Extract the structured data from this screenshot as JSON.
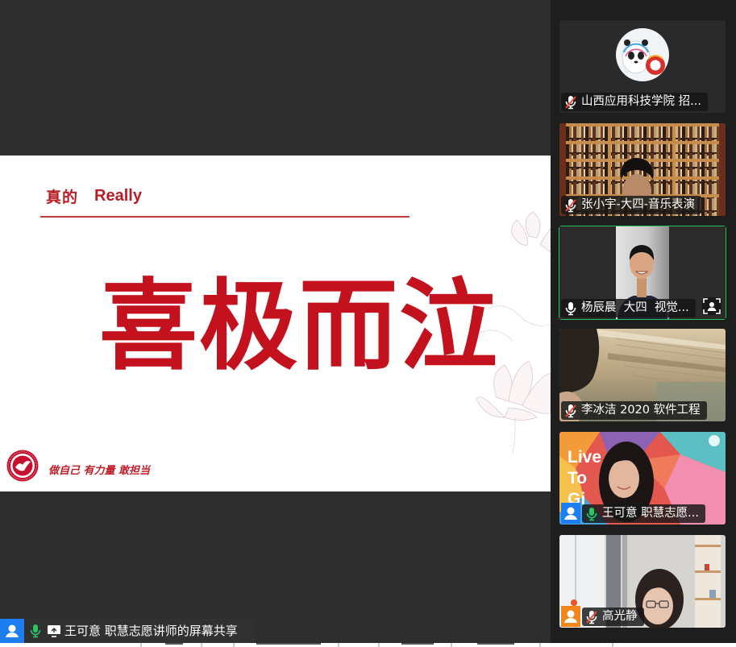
{
  "theme": {
    "main_bg": "#2d2d2d",
    "panel_bg": "#1e1e1e",
    "active_speaker_border": "#23c25c",
    "slide_red": "#c3121e"
  },
  "shared_screen": {
    "slide": {
      "heading_cn": "真的",
      "heading_en": "Really",
      "main_text": "喜极而泣",
      "slogan": "做自己 有力量 敢担当",
      "logo_icon": "school-emblem-icon",
      "decoration_icon": "lotus-sketch-icon"
    },
    "share_bar": {
      "label": "王可意 职慧志愿讲师的屏幕共享",
      "avatar_icon": "person-icon",
      "avatar_color": "#1d7df2",
      "mic_icon": "mic-on-icon",
      "share_icon": "screen-share-icon"
    }
  },
  "participants": [
    {
      "name": "山西应用科技学院 招...",
      "mic_icon": "mic-muted-icon"
    },
    {
      "name": "张小宇-大四-音乐表演",
      "mic_icon": "mic-muted-icon"
    },
    {
      "name": "杨辰晨  大四  视觉...",
      "mic_icon": "mic-on-icon",
      "active_speaker": true,
      "extra_icon": "person-frame-icon"
    },
    {
      "name": "李冰洁 2020 软件工程",
      "mic_icon": "mic-muted-icon"
    },
    {
      "name": "王可意 职慧志愿...",
      "mic_icon": "mic-on-icon",
      "avatar_icon": "person-icon",
      "avatar_color": "#1d7df2",
      "video_text": [
        "Live",
        "To",
        "Gi"
      ]
    },
    {
      "name": "高光静",
      "mic_icon": "mic-muted-icon",
      "avatar_icon": "person-icon",
      "avatar_color": "#f0861c"
    }
  ]
}
